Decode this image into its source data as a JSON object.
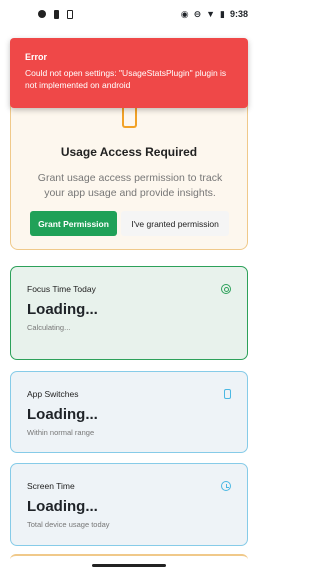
{
  "status_bar": {
    "time": "9:38",
    "left_icons": [
      "camera-icon",
      "sim-icon",
      "battery-charge-icon"
    ],
    "right_icons": [
      "eye-icon",
      "do-not-disturb-icon",
      "wifi-icon",
      "battery-icon"
    ]
  },
  "error_toast": {
    "title": "Error",
    "message": "Could not open settings: \"UsageStatsPlugin\" plugin is not implemented on android"
  },
  "usage_access": {
    "title": "Usage Access Required",
    "description": "Grant usage access permission to track your app usage and provide insights.",
    "grant_button": "Grant Permission",
    "granted_button": "I've granted permission"
  },
  "cards": [
    {
      "title": "Focus Time Today",
      "value": "Loading...",
      "subtitle": "Calculating...",
      "icon": "target-icon",
      "accent": "#2da15a"
    },
    {
      "title": "App Switches",
      "value": "Loading...",
      "subtitle": "Within normal range",
      "icon": "phone-icon",
      "accent": "#4bb8e3"
    },
    {
      "title": "Screen Time",
      "value": "Loading...",
      "subtitle": "Total device usage today",
      "icon": "clock-icon",
      "accent": "#4bb8e3"
    }
  ],
  "colors": {
    "error": "#ef4848",
    "grant": "#20a158",
    "warning": "#f2a227"
  }
}
